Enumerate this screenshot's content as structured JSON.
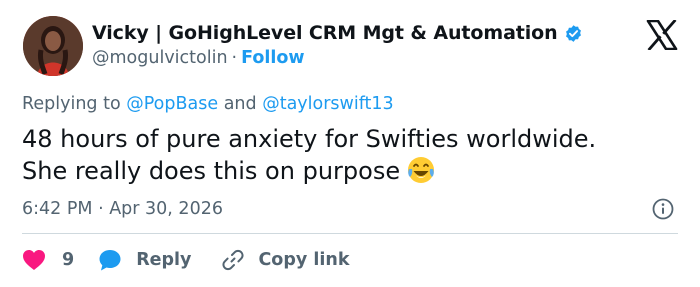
{
  "author": {
    "display_name": "Vicky | GoHighLevel CRM Mgt & Automation",
    "handle": "@mogulvictolin",
    "separator": "·",
    "follow_label": "Follow"
  },
  "replying": {
    "prefix": "Replying to",
    "mention_1": "@PopBase",
    "conjunction": "and",
    "mention_2": "@taylorswift13"
  },
  "tweet": {
    "line_1": "48 hours of pure anxiety for Swifties worldwide.",
    "line_2": "She really does this on purpose",
    "emoji": "face-with-tears-of-joy"
  },
  "meta": {
    "timestamp": "6:42 PM · Apr 30, 2026"
  },
  "actions": {
    "like_count": "9",
    "reply_label": "Reply",
    "copy_label": "Copy link"
  },
  "colors": {
    "text": "#0f1419",
    "secondary": "#536471",
    "accent": "#1d9bf0",
    "like": "#f91880",
    "divider": "#cfd9de"
  },
  "icons": {
    "verified": "verified-badge-icon",
    "brand": "x-logo-icon",
    "info": "info-icon",
    "like": "heart-icon",
    "reply": "speech-bubble-icon",
    "copy": "link-icon"
  }
}
